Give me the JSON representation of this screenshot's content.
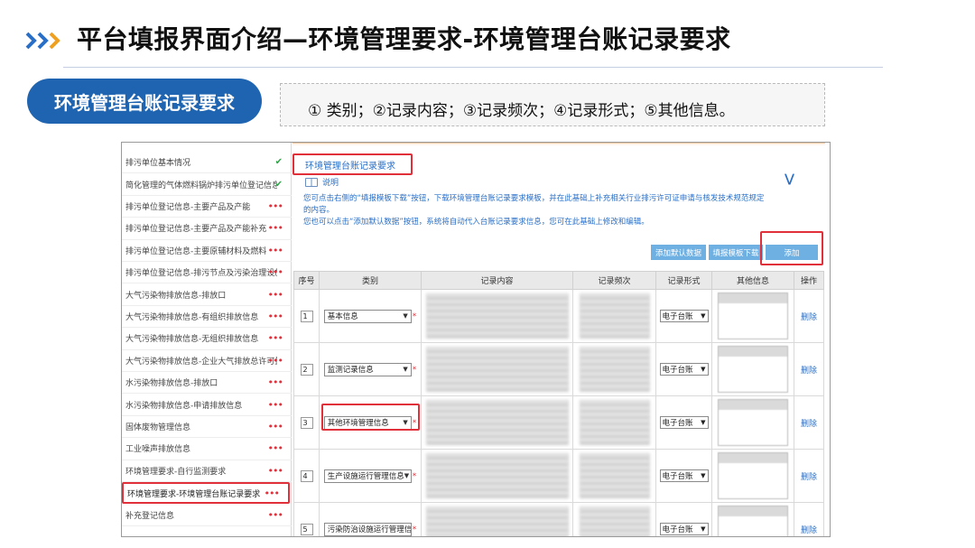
{
  "slide": {
    "title": "平台填报界面介绍—环境管理要求-环境管理台账记录要求",
    "section_pill": "环境管理台账记录要求",
    "description": "① 类别；②记录内容；③记录频次；④记录形式；⑤其他信息。",
    "accent_color": "#1f64b0",
    "highlight_color": "#e2303a"
  },
  "sidebar": {
    "items": [
      {
        "label": "排污单位基本情况",
        "status": "complete-check-icon"
      },
      {
        "label": "简化管理的气体燃料锅炉排污单位登记信息",
        "status": "complete-check-icon"
      },
      {
        "label": "排污单位登记信息-主要产品及产能",
        "status": "pending-dots-icon"
      },
      {
        "label": "排污单位登记信息-主要产品及产能补充",
        "status": "pending-dots-icon"
      },
      {
        "label": "排污单位登记信息-主要原辅材料及燃料",
        "status": "pending-dots-icon"
      },
      {
        "label": "排污单位登记信息-排污节点及污染治理设施",
        "status": "pending-dots-icon"
      },
      {
        "label": "大气污染物排放信息-排放口",
        "status": "pending-dots-icon"
      },
      {
        "label": "大气污染物排放信息-有组织排放信息",
        "status": "pending-dots-icon"
      },
      {
        "label": "大气污染物排放信息-无组织排放信息",
        "status": "pending-dots-icon"
      },
      {
        "label": "大气污染物排放信息-企业大气排放总许可量",
        "status": "pending-dots-icon"
      },
      {
        "label": "水污染物排放信息-排放口",
        "status": "pending-dots-icon"
      },
      {
        "label": "水污染物排放信息-申请排放信息",
        "status": "pending-dots-icon"
      },
      {
        "label": "固体废物管理信息",
        "status": "pending-dots-icon"
      },
      {
        "label": "工业噪声排放信息",
        "status": "pending-dots-icon"
      },
      {
        "label": "环境管理要求-自行监测要求",
        "status": "pending-dots-icon"
      },
      {
        "label": "环境管理要求-环境管理台账记录要求",
        "status": "pending-dots-icon"
      },
      {
        "label": "补充登记信息",
        "status": "pending-dots-icon"
      }
    ],
    "active_index": 15
  },
  "main": {
    "section_tab": "环境管理台账记录要求",
    "notes_title": "说明",
    "note_lines": [
      "您可点击右侧的“填报模板下载”按钮，下载环境管理台账记录要求模板，并在此基础上补充相关行业排污许可证申请与核发技术规范规定",
      "的内容。",
      "您也可以点击“添加默认数据”按钮，系统将自动代入台账记录要求信息，您可在此基础上修改和编辑。"
    ],
    "buttons": {
      "add_default": "添加默认数据",
      "download_template": "填报模板下载",
      "add": "添加"
    },
    "table": {
      "headers": [
        "序号",
        "类别",
        "记录内容",
        "记录频次",
        "记录形式",
        "其他信息",
        "操作"
      ],
      "rows": [
        {
          "seq": "1",
          "category": "基本信息",
          "format": "电子台账",
          "action": "删除"
        },
        {
          "seq": "2",
          "category": "监测记录信息",
          "format": "电子台账",
          "action": "删除"
        },
        {
          "seq": "3",
          "category": "其他环境管理信息",
          "format": "电子台账",
          "action": "删除"
        },
        {
          "seq": "4",
          "category": "生产设施运行管理信息",
          "format": "电子台账",
          "action": "删除"
        },
        {
          "seq": "5",
          "category": "污染防治设施运行管理信息",
          "format": "电子台账",
          "action": "删除"
        }
      ],
      "highlighted_row_index": 2
    }
  }
}
